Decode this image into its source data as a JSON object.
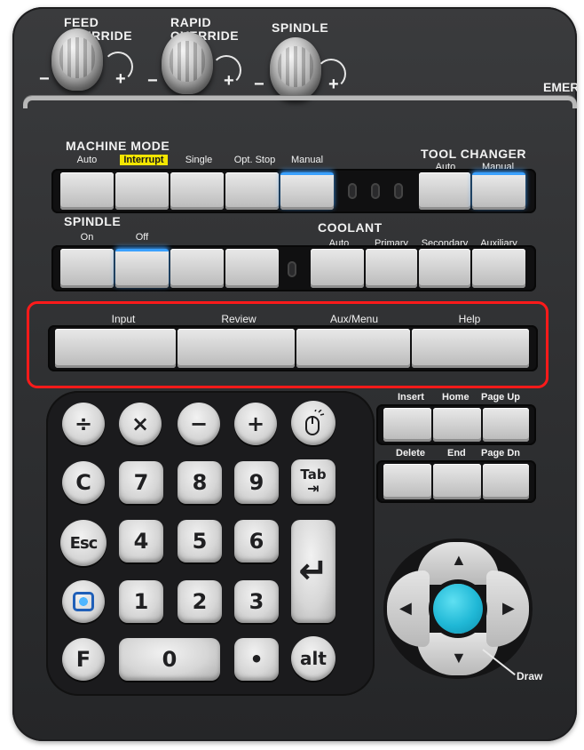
{
  "knobs": [
    {
      "name": "feed-override",
      "label": "FEED\nOVERRIDE",
      "minus": "−",
      "plus": "+"
    },
    {
      "name": "rapid-override",
      "label": "RAPID\nOVERRIDE",
      "minus": "−",
      "plus": "+"
    },
    {
      "name": "spindle-override",
      "label": "SPINDLE",
      "minus": "−",
      "plus": "+"
    }
  ],
  "emergency_label": "EMERG",
  "machine_mode": {
    "title": "MACHINE MODE",
    "keys": [
      {
        "label": "Auto",
        "lit": false,
        "highlighted": false
      },
      {
        "label": "Interrupt",
        "lit": false,
        "highlighted": true
      },
      {
        "label": "Single",
        "lit": false,
        "highlighted": false
      },
      {
        "label": "Opt. Stop",
        "lit": false,
        "highlighted": false
      },
      {
        "label": "Manual",
        "lit": true,
        "highlighted": false
      }
    ]
  },
  "tool_changer": {
    "title": "TOOL CHANGER",
    "keys": [
      {
        "label": "Auto",
        "lit": false
      },
      {
        "label": "Manual",
        "lit": true
      }
    ]
  },
  "spindle": {
    "title": "SPINDLE",
    "keys": [
      {
        "label": "On",
        "lit": false
      },
      {
        "label": "Off",
        "lit": true
      },
      {
        "label": "",
        "lit": false
      },
      {
        "label": "",
        "lit": false
      }
    ]
  },
  "coolant": {
    "title": "COOLANT",
    "keys": [
      {
        "label": "Auto"
      },
      {
        "label": "Primary"
      },
      {
        "label": "Secondary"
      },
      {
        "label": "Auxiliary"
      }
    ]
  },
  "function_keys": [
    {
      "label": "Input"
    },
    {
      "label": "Review"
    },
    {
      "label": "Aux/Menu"
    },
    {
      "label": "Help"
    }
  ],
  "keypad": {
    "row1": [
      "÷",
      "×",
      "−",
      "+"
    ],
    "row2": [
      "C",
      "7",
      "8",
      "9"
    ],
    "row3": [
      "Esc",
      "4",
      "5",
      "6"
    ],
    "row4": [
      "",
      "1",
      "2",
      "3"
    ],
    "row5": [
      "F",
      "0",
      "•",
      "alt"
    ],
    "tab": "Tab",
    "tab_arrow": "⇥",
    "enter_symbol": "↵"
  },
  "nav_keys": {
    "top_labels": [
      "Insert",
      "Home",
      "Page Up"
    ],
    "bottom_labels": [
      "Delete",
      "End",
      "Page Dn"
    ]
  },
  "dpad": {
    "up": "▲",
    "down": "▼",
    "left": "◀",
    "right": "▶",
    "draw_label": "Draw",
    "center_color": "#20b8d6"
  },
  "colors": {
    "highlight_box": "#ff1a1a",
    "led_blue": "#3aa0ff",
    "interrupt_tag": "#f3e600"
  }
}
